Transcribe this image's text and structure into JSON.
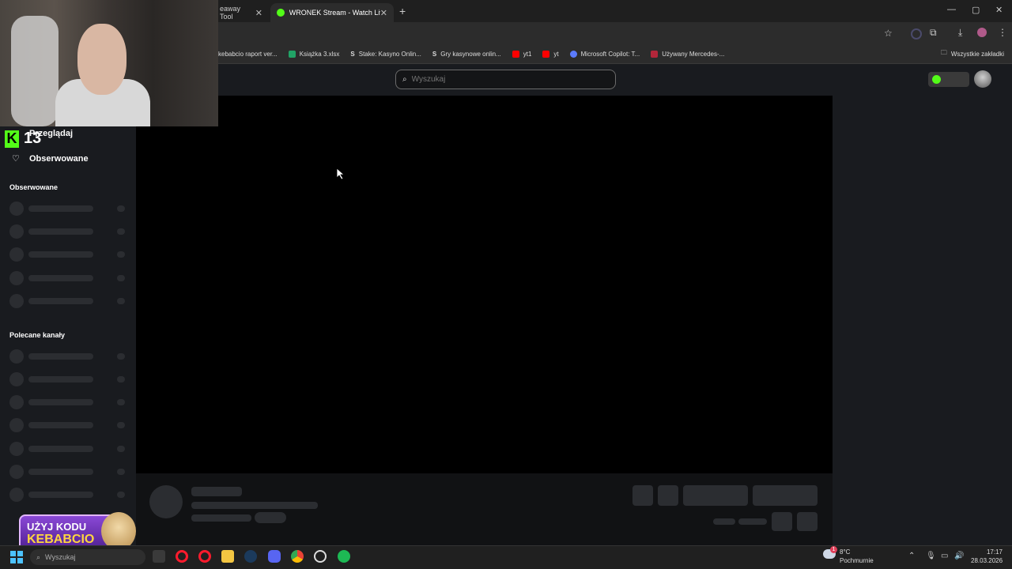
{
  "browser": {
    "tabs": [
      {
        "label": "eaway Tool",
        "active": false
      },
      {
        "label": "WRONEK Stream - Watch Live o",
        "active": true
      }
    ],
    "new_tab": "+",
    "window_controls": [
      "—",
      "▢",
      "✕"
    ],
    "bookmarks": [
      {
        "label": "kebabcio raport ver...",
        "icon_color": "#2b2b2b"
      },
      {
        "label": "Książka 3.xlsx",
        "icon_color": "#21a366"
      },
      {
        "label": "Stake: Kasyno Onlin...",
        "icon_color": "#cccccc"
      },
      {
        "label": "Gry kasynowe onlin...",
        "icon_color": "#cccccc"
      },
      {
        "label": "yt1",
        "icon_color": "#ff0000"
      },
      {
        "label": "yt",
        "icon_color": "#ff0000"
      },
      {
        "label": "Microsoft Copilot: T...",
        "icon_color": "#5b7bff"
      },
      {
        "label": "Używany Mercedes-...",
        "icon_color": "#b3263a"
      }
    ],
    "all_bookmarks": "Wszystkie zakładki"
  },
  "header": {
    "search_placeholder": "Wyszukaj"
  },
  "kick": {
    "badge_letter": "K",
    "count": "13"
  },
  "sidebar": {
    "browse": "Przeglądaj",
    "following_nav": "Obserwowane",
    "following_section": "Obserwowane",
    "recommended_section": "Polecane kanały"
  },
  "promo": {
    "line1": "UŻYJ KODU",
    "line2": "KEBABCIO"
  },
  "taskbar": {
    "search_text": "Wyszukaj",
    "weather_temp": "8°C",
    "weather_desc": "Pochmurnie",
    "notification_count": "1",
    "time": "17:17",
    "date": "28.03.2026"
  },
  "colors": {
    "kick_green": "#53fc18",
    "sidebar_bg": "#191b1f",
    "skeleton": "#2b2d31"
  }
}
